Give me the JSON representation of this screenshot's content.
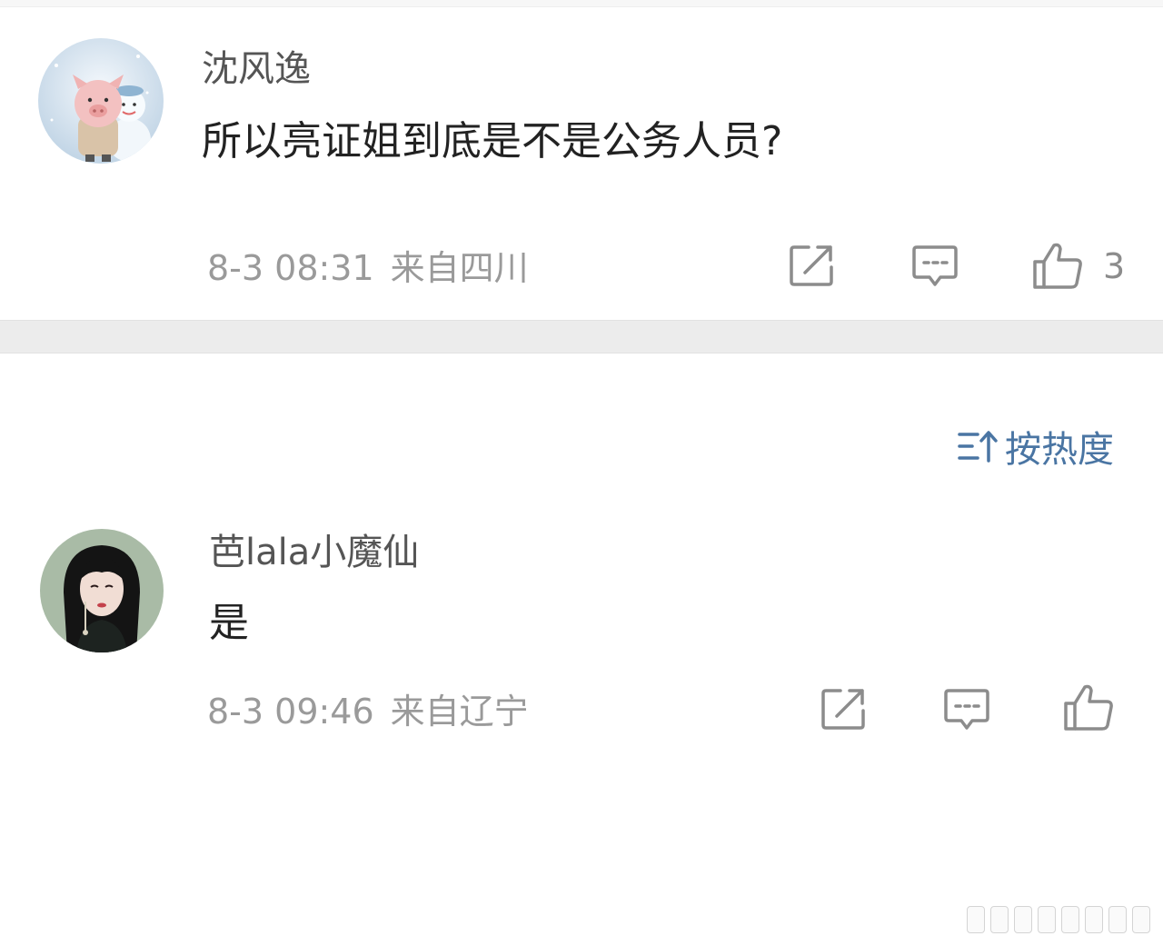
{
  "comments": [
    {
      "username": "沈风逸",
      "content": "所以亮证姐到底是不是公务人员?",
      "time": "8-3 08:31",
      "location": "来自四川",
      "like_count": "3",
      "avatar_icon": "pig-snowman-avatar"
    },
    {
      "username": "芭lala小魔仙",
      "content": "是",
      "time": "8-3 09:46",
      "location": "来自辽宁",
      "like_count": "",
      "avatar_icon": "girl-portrait-avatar"
    }
  ],
  "sort": {
    "label": "按热度",
    "icon": "sort-icon"
  },
  "colors": {
    "accent": "#4a75a3",
    "meta_text": "#9a9a9a",
    "divider": "#ececec"
  }
}
